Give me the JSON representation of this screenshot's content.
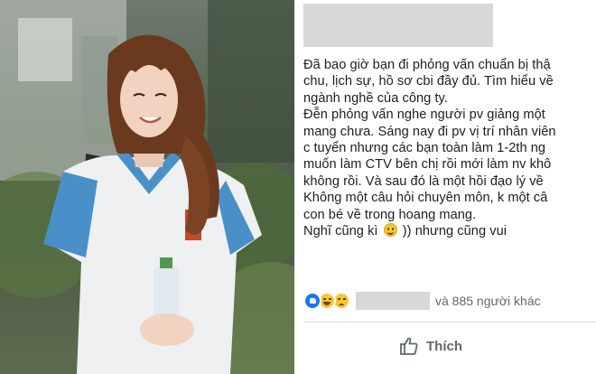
{
  "post": {
    "author_redacted": true,
    "lines": [
      "Đã bao giờ bạn đi phỏng vấn chuẩn bị thậ",
      "chu, lịch sự, hồ sơ cbi đầy đủ. Tìm hiểu về",
      "ngành nghề của công ty.",
      "Đễn phỏng vấn nghe người pv giảng một",
      "mang chưa. Sáng nay đi pv vị trí nhân viên",
      "c tuyển nhưng các bạn toàn làm 1-2th ng",
      "muốn làm CTV bên chị rồi mới làm nv khô",
      "không rồi. Và sau đó là một hồi đạo lý về",
      "Không một câu hỏi chuyên môn, k một câ",
      "con bé về trong hoang mang.",
      "Nghĩ cũng kì",
      ")) nhưng cũng vui"
    ],
    "emoji_inline": "slightly-smiling-face",
    "reactions": {
      "icons": [
        "like-reaction-icon",
        "haha-reaction-icon",
        "sad-reaction-icon"
      ],
      "others_text": "và 885 người khác"
    },
    "like_button_label": "Thích"
  },
  "colors": {
    "facebook_blue": "#1877f2",
    "text": "#1c1e21",
    "muted": "#606770",
    "redaction": "#d8d8d8"
  }
}
